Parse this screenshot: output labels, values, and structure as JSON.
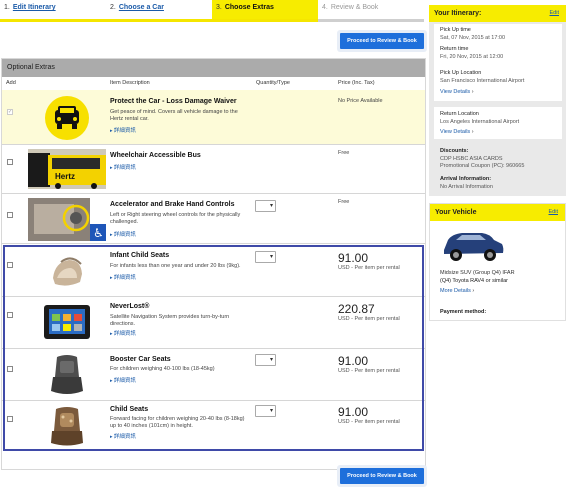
{
  "steps": [
    {
      "num": "1.",
      "label": "Edit Itinerary"
    },
    {
      "num": "2.",
      "label": "Choose a Car"
    },
    {
      "num": "3.",
      "label": "Choose Extras"
    },
    {
      "num": "4.",
      "label": "Review & Book"
    }
  ],
  "proceed_label": "Proceed to Review & Book",
  "extras": {
    "title": "Optional Extras",
    "columns": {
      "add": "Add",
      "item": "Item Description",
      "qty": "Quantity/Type",
      "price": "Price (Inc. Tax)"
    },
    "items": [
      {
        "name": "Protect the Car - Loss Damage Waiver",
        "desc": "Get peace of mind. Covers all vehicle damage to the Hertz rental car.",
        "more": "詳細資訊",
        "price_note": "No Price Available",
        "checked_mark": "✓"
      },
      {
        "name": "Wheelchair Accessible Bus",
        "desc": "",
        "more": "詳細資訊",
        "price_note": "Free"
      },
      {
        "name": "Accelerator and Brake Hand Controls",
        "desc": "Left or Right steering wheel controls for the physically challenged.",
        "more": "詳細資訊",
        "price_note": "Free"
      },
      {
        "name": "Infant Child Seats",
        "desc": "For infants less than one year and under 20 lbs (9kg).",
        "more": "詳細資訊",
        "price": "91.00",
        "price_sub": "USD - Per item per rental"
      },
      {
        "name": "NeverLost®",
        "desc": "Satellite Navigation System provides turn-by-turn directions.",
        "more": "詳細資訊",
        "price": "220.87",
        "price_sub": "USD - Per item per rental"
      },
      {
        "name": "Booster Car Seats",
        "desc": "For children weighing 40-100 lbs (18-45kg)",
        "more": "詳細資訊",
        "price": "91.00",
        "price_sub": "USD - Per item per rental"
      },
      {
        "name": "Child Seats",
        "desc": "Forward facing for children weighing 20-40 lbs (8-18kg) up to 40 inches (101cm) in height.",
        "more": "詳細資訊",
        "price": "91.00",
        "price_sub": "USD - Per item per rental"
      }
    ]
  },
  "itinerary": {
    "title": "Your Itinerary:",
    "edit": "Edit",
    "pickup_time_label": "Pick Up time",
    "pickup_time": "Sat, 07 Nov, 2015 at 17:00",
    "return_time_label": "Return time",
    "return_time": "Fri, 20 Nov, 2015 at 12:00",
    "pickup_loc_label": "Pick Up Location",
    "pickup_loc": "San Francisco International Airport",
    "view_details": "View Details",
    "return_loc_label": "Return Location",
    "return_loc": "Los Angeles International Airport",
    "discounts_label": "Discounts:",
    "discount_1": "CDP HSBC ASIA CARDS",
    "discount_2": "Promotional Coupon (PC): 960665",
    "arrival_label": "Arrival Information:",
    "arrival": "No Arrival Information"
  },
  "vehicle": {
    "title": "Your Vehicle",
    "edit": "Edit",
    "line1": "Midsize SUV (Group Q4) IFAR",
    "line2": "(Q4) Toyota RAV4 or similar",
    "more": "More Details",
    "payment": "Payment method:"
  },
  "colors": {
    "accent": "#f7ec00",
    "button": "#1e6fdb",
    "link": "#1a5aa8",
    "frame": "#3f4aa8"
  }
}
